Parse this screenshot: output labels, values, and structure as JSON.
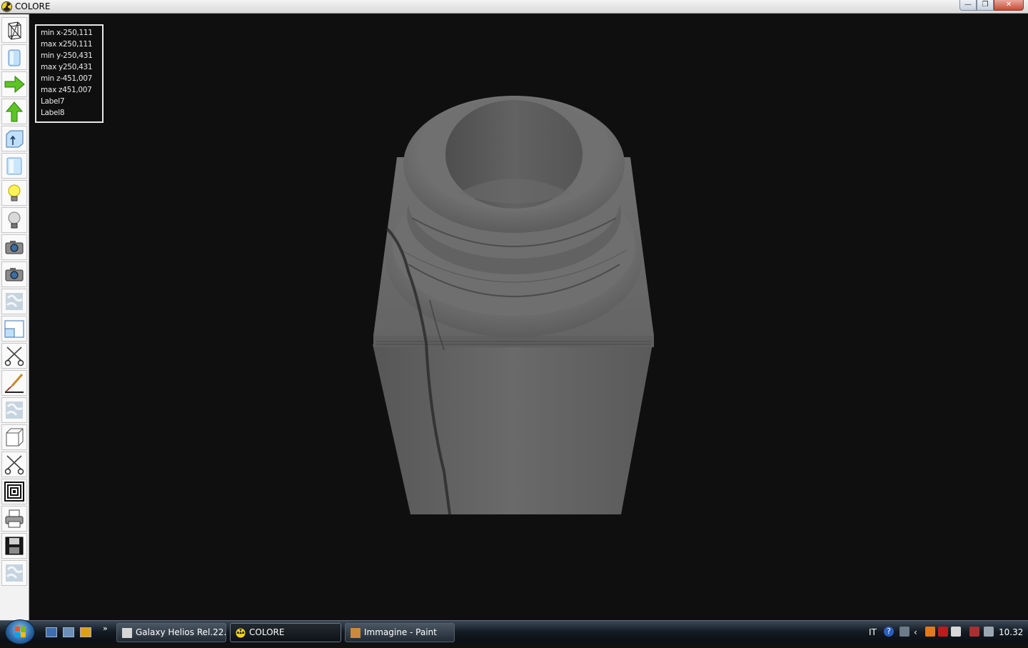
{
  "window": {
    "title": "COLORE",
    "buttons": {
      "minimize": "—",
      "restore": "❐",
      "close": "✕"
    }
  },
  "toolbar": {
    "tools": [
      "wireframe-box-icon",
      "solid-cylinder-icon",
      "arrow-right-icon",
      "arrow-up-icon",
      "box-up-icon",
      "cylinder-icon",
      "light-on-icon",
      "light-off-icon",
      "camera-icon",
      "camera-icon-2",
      "texture-icon",
      "split-view-icon",
      "scissors-icon",
      "brush-icon",
      "texture-icon-2",
      "cube-icon",
      "scissors-icon-2",
      "concentric-squares-icon",
      "printer-icon",
      "save-icon",
      "texture-icon-3"
    ]
  },
  "info": {
    "lines": [
      "min x-250,111",
      "max x250,111",
      "min y-250,431",
      "max y250,431",
      "min z-451,007",
      "max z451,007",
      "Label7",
      "Label8"
    ]
  },
  "taskbar": {
    "quick_launch_more": "»",
    "tasks": [
      {
        "label": "Galaxy Helios  Rel.22...",
        "active": false
      },
      {
        "label": "COLORE",
        "active": true
      },
      {
        "label": "Immagine - Paint",
        "active": false
      }
    ],
    "tray": {
      "language": "IT",
      "clock": "10.32",
      "help": "?"
    }
  },
  "colors": {
    "viewport_bg": "#0f0f0f",
    "marble": "#6b6b6b",
    "accent_green": "#4caf1a"
  }
}
